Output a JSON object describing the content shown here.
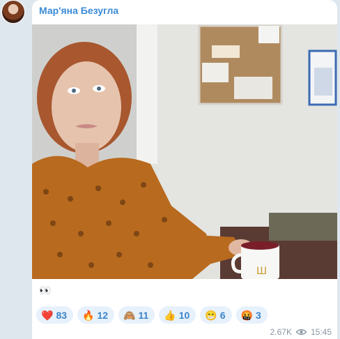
{
  "message": {
    "author": "Мар'яна Безугла",
    "caption": "👀",
    "views": "2.67K",
    "time": "15:45"
  },
  "reactions": [
    {
      "emoji": "❤️",
      "count": "83",
      "icon": "heart-icon"
    },
    {
      "emoji": "🔥",
      "count": "12",
      "icon": "fire-icon"
    },
    {
      "emoji": "🙈",
      "count": "11",
      "icon": "see-no-evil-monkey-icon"
    },
    {
      "emoji": "👍",
      "count": "10",
      "icon": "thumbs-up-icon"
    },
    {
      "emoji": "😁",
      "count": "6",
      "icon": "grin-icon"
    },
    {
      "emoji": "🤬",
      "count": "3",
      "icon": "swearing-face-icon"
    }
  ],
  "colors": {
    "author_name": "#3a8bd6",
    "reaction_bg": "#e7f1fb",
    "reaction_text": "#3a84c9",
    "chat_background": "#dfe7ee"
  },
  "icons": {
    "views": "eye-icon"
  }
}
